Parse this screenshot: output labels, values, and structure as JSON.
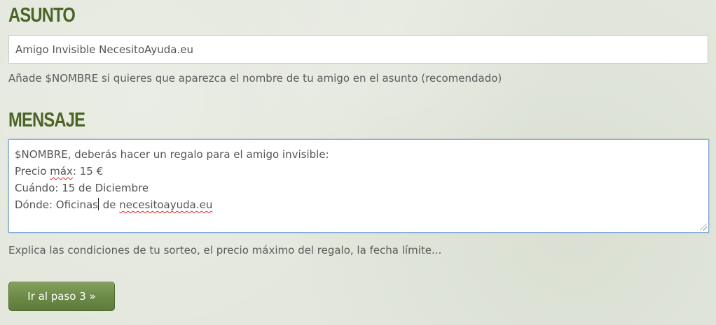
{
  "asunto": {
    "heading": "ASUNTO",
    "value": "Amigo Invisible NecesitoAyuda.eu",
    "help": "Añade $NOMBRE si quieres que aparezca el nombre de tu amigo en el asunto (recomendado)"
  },
  "mensaje": {
    "heading": "MENSAJE",
    "line1": "$NOMBRE, deberás hacer un regalo para el amigo invisible:",
    "line2_prefix": "Precio ",
    "line2_misspelled": "máx",
    "line2_suffix": ": 15 €",
    "line3": "Cuándo: 15 de Diciembre",
    "line4_before_caret": "Dónde: Oficinas",
    "line4_after_caret": " de ",
    "line4_misspelled": "necesitoayuda.eu",
    "help": "Explica las condiciones de tu sorteo, el precio máximo del regalo, la fecha límite..."
  },
  "actions": {
    "next_label": "Ir al paso 3 »"
  },
  "colors": {
    "heading": "#4b6525",
    "button": "#6b8946",
    "focus_border": "#7fa6d8",
    "spellcheck": "#e02020"
  }
}
